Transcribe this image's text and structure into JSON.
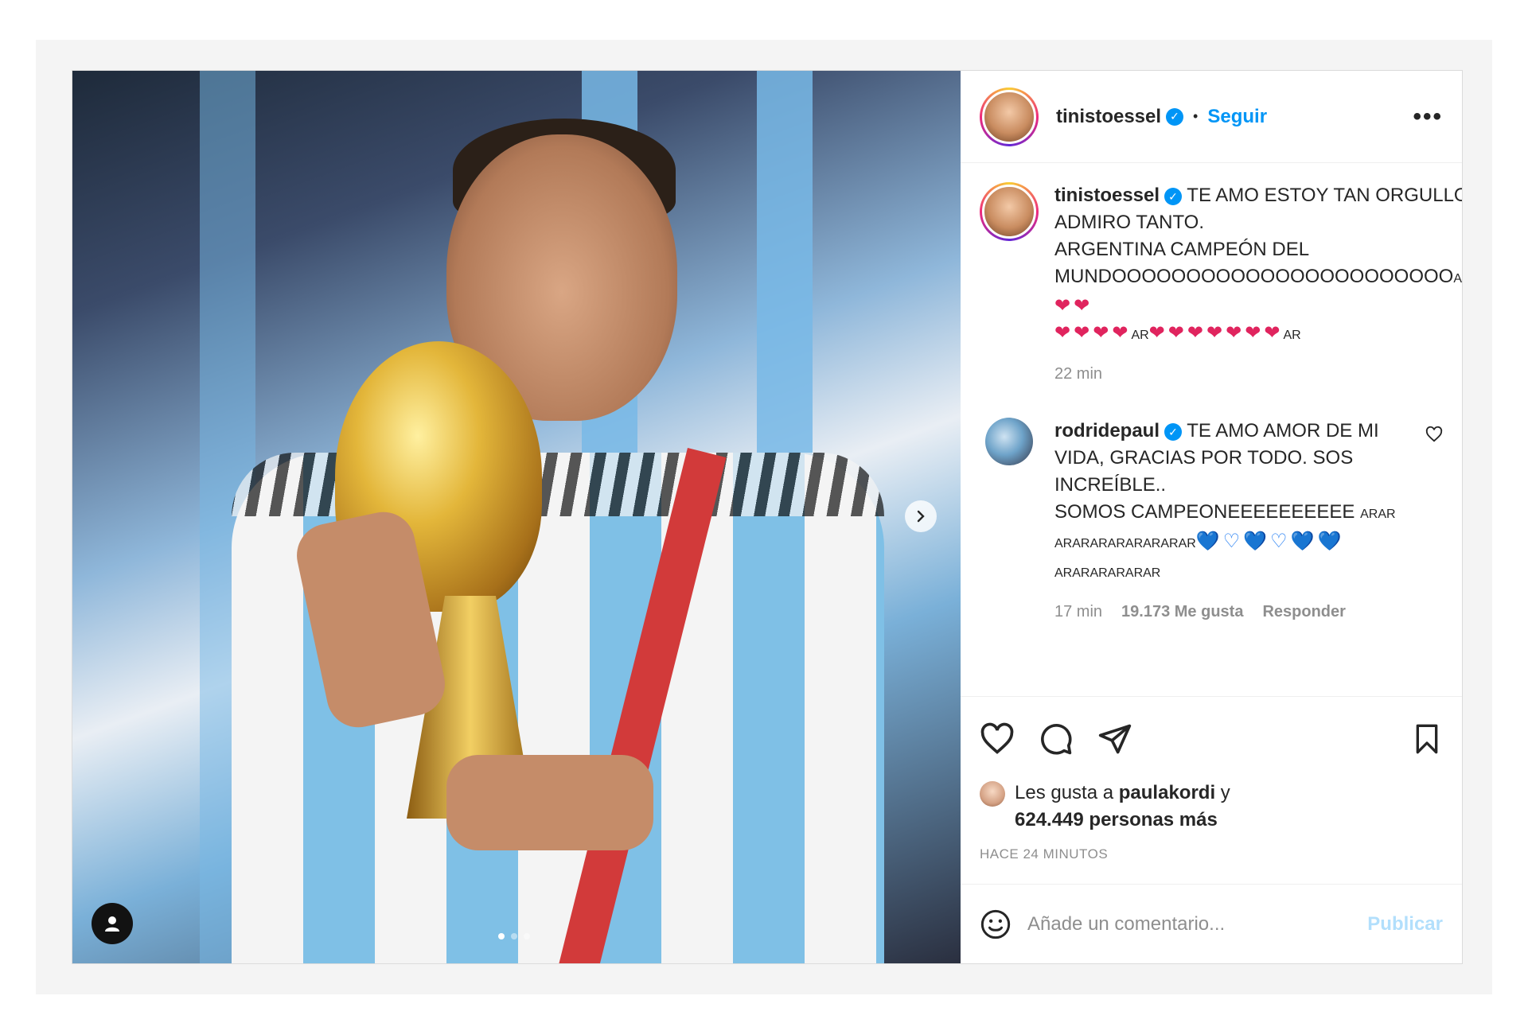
{
  "post": {
    "author": "tinistoessel",
    "follow_label": "Seguir",
    "separator": "•",
    "more_label": "•••"
  },
  "caption": {
    "author": "tinistoessel",
    "line1": "TE AMO ESTOY TAN ORGULLOSA DE VOS Y TE ADMIRO TANTO.",
    "line2": "ARGENTINA CAMPEÓN DEL MUNDOOOOOOOOOOOOOOOOOOOOOOO",
    "line2_suffix": "ARARARARARARAR□□□□□□",
    "line2_hearts": "❤❤",
    "line3_hearts_a": "❤❤❤❤",
    "line3_ar_a": "AR",
    "line3_hearts_b": "❤❤❤❤❤❤❤",
    "line3_ar_b": "AR",
    "time": "22 min"
  },
  "reply": {
    "author": "rodridepaul",
    "line1": "TE AMO AMOR DE MI VIDA, GRACIAS POR TODO. SOS INCREÍBLE..",
    "line2": "SOMOS CAMPEONEEEEEEEEEE",
    "line2_ar": "ARAR",
    "line3_ar": "ARARARARARARARAR",
    "line3_hearts": "💙♡💙♡💙💙",
    "line4_ar": "ARARARARARAR",
    "time": "17 min",
    "likes": "19.173 Me gusta",
    "reply_label": "Responder"
  },
  "likes": {
    "prefix": "Les gusta a",
    "user": "paulakordi",
    "joiner": "y",
    "count": "624.449 personas más"
  },
  "time_ago": "HACE 24 MINUTOS",
  "composer": {
    "placeholder": "Añade un comentario...",
    "publish_label": "Publicar"
  },
  "icons": {
    "verified": "verified-badge-icon",
    "like": "heart-icon",
    "comment": "comment-icon",
    "share": "share-icon",
    "save": "bookmark-icon",
    "emoji": "emoji-icon",
    "user_tag": "user-icon",
    "next": "chevron-right-icon"
  },
  "colors": {
    "accent": "#0095f6",
    "publish_disabled": "#b2dffc",
    "muted": "#8e8e8e",
    "heart_red": "#e0245e"
  },
  "carousel": {
    "total": 3,
    "active": 1
  }
}
